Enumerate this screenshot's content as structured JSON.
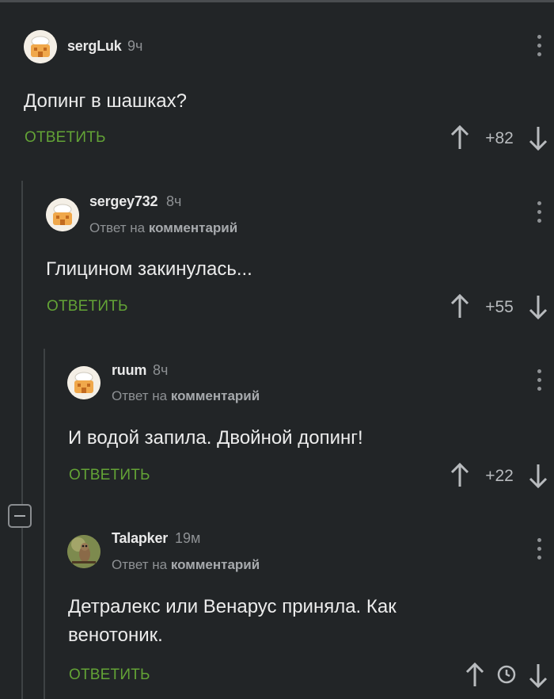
{
  "colors": {
    "background": "#222527",
    "reply_green": "#63a336",
    "text": "#ececec",
    "muted": "#8e9194"
  },
  "comments": [
    {
      "author": "sergLuk",
      "time": "9ч",
      "text": "Допинг в шашках?",
      "reply_label": "ОТВЕТИТЬ",
      "score": "+82",
      "reply_to": null
    },
    {
      "author": "sergey732",
      "time": "8ч",
      "reply_prefix": "Ответ на",
      "reply_target": "комментарий",
      "text": "Глицином закинулась...",
      "reply_label": "ОТВЕТИТЬ",
      "score": "+55"
    },
    {
      "author": "ruum",
      "time": "8ч",
      "reply_prefix": "Ответ на",
      "reply_target": "комментарий",
      "text": "И водой запила. Двойной допинг!",
      "reply_label": "ОТВЕТИТЬ",
      "score": "+22"
    },
    {
      "author": "Talapker",
      "time": "19м",
      "reply_prefix": "Ответ на",
      "reply_target": "комментарий",
      "text": "Детралекс или Венарус приняла. Как венотоник.",
      "reply_label": "ОТВЕТИТЬ",
      "score_icon": "clock-icon"
    }
  ],
  "icons": {
    "upvote": "arrow-up-icon",
    "downvote": "arrow-down-icon",
    "menu": "more-vertical-icon",
    "collapse": "minus-square-icon",
    "pending": "clock-icon"
  }
}
